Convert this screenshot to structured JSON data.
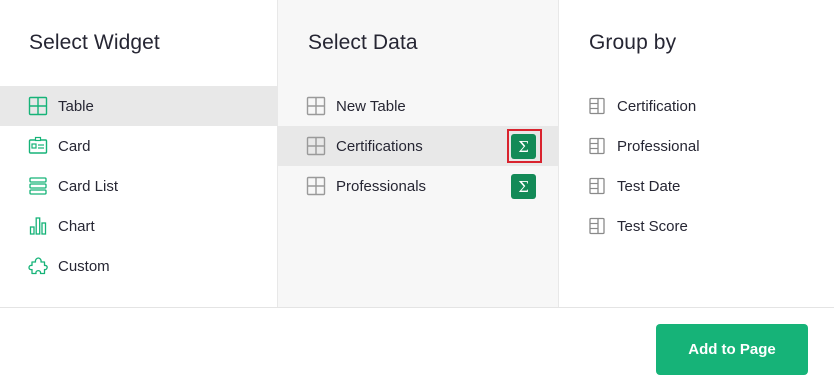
{
  "colors": {
    "accent": "#16b378",
    "sum_button": "#138a57",
    "highlight": "#d9232e",
    "selected_row": "#e8e8e8",
    "middle_column_bg": "#f7f7f7"
  },
  "widget": {
    "title": "Select Widget",
    "items": [
      {
        "label": "Table",
        "icon": "table-icon",
        "selected": true
      },
      {
        "label": "Card",
        "icon": "card-icon",
        "selected": false
      },
      {
        "label": "Card List",
        "icon": "card-list-icon",
        "selected": false
      },
      {
        "label": "Chart",
        "icon": "chart-icon",
        "selected": false
      },
      {
        "label": "Custom",
        "icon": "custom-puzzle-icon",
        "selected": false
      }
    ]
  },
  "data": {
    "title": "Select Data",
    "items": [
      {
        "label": "New Table",
        "icon": "table-icon",
        "selected": false,
        "summary": false
      },
      {
        "label": "Certifications",
        "icon": "table-icon",
        "selected": true,
        "summary": true,
        "summary_symbol": "Σ"
      },
      {
        "label": "Professionals",
        "icon": "table-icon",
        "selected": false,
        "summary": true,
        "summary_symbol": "Σ"
      }
    ]
  },
  "group": {
    "title": "Group by",
    "items": [
      {
        "label": "Certification",
        "icon": "column-icon"
      },
      {
        "label": "Professional",
        "icon": "column-icon"
      },
      {
        "label": "Test Date",
        "icon": "column-icon"
      },
      {
        "label": "Test Score",
        "icon": "column-icon"
      }
    ]
  },
  "footer": {
    "add_label": "Add to Page"
  }
}
